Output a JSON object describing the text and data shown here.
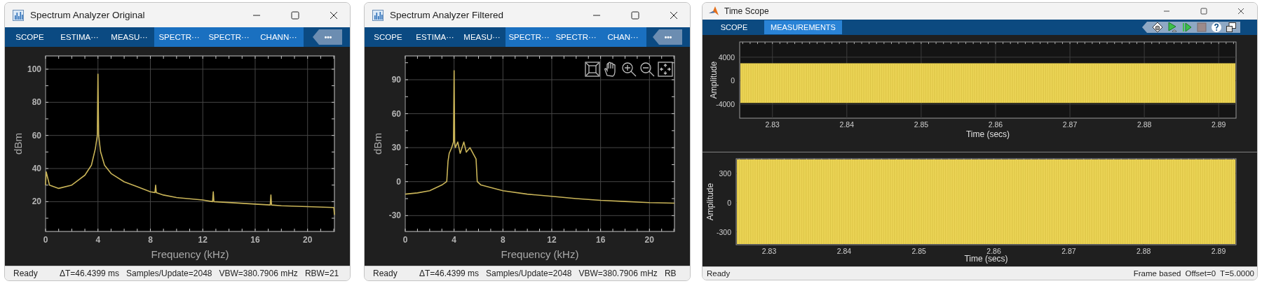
{
  "windows": [
    {
      "kind": "spectrum",
      "title": "Spectrum Analyzer Original",
      "tabs": [
        {
          "label": "SCOPE",
          "kind": "main"
        },
        {
          "label": "ESTIMA···",
          "kind": "main"
        },
        {
          "label": "MEASU···",
          "kind": "main"
        },
        {
          "label": "SPECTR···",
          "kind": "contextual"
        },
        {
          "label": "SPECTR···",
          "kind": "contextual"
        },
        {
          "label": "CHANN···",
          "kind": "contextual"
        }
      ],
      "overflow_button": "•••",
      "plot": {
        "chart_data": {
          "type": "line",
          "grid": true,
          "xlabel": "Frequency (kHz)",
          "ylabel": "dBm",
          "xlim": [
            0,
            22.05
          ],
          "ylim": [
            2,
            108
          ],
          "xticks": [
            0,
            4,
            8,
            12,
            16,
            20
          ],
          "yticks": [
            20,
            40,
            60,
            80,
            100
          ],
          "x": [
            0,
            0.05,
            0.3,
            1,
            2,
            3,
            3.5,
            3.8,
            3.95,
            4,
            4.05,
            4.2,
            4.5,
            5,
            6,
            7,
            8,
            8.35,
            8.4,
            8.45,
            9,
            10,
            12,
            12.75,
            12.8,
            12.85,
            14,
            16,
            17.15,
            17.2,
            17.25,
            18,
            20,
            22,
            22.05
          ],
          "series": [
            {
              "color": "#c9b458",
              "values": [
                30,
                38,
                30,
                28,
                30,
                36,
                42,
                52,
                60,
                97,
                60,
                50,
                42,
                37,
                32,
                29,
                26,
                25.5,
                30,
                25.5,
                24,
                22.5,
                21,
                20,
                26,
                20,
                19.5,
                18.5,
                18,
                24,
                18,
                17.5,
                17,
                16.5,
                12
              ]
            }
          ]
        }
      },
      "status_bar": {
        "left": "Ready",
        "fields": [
          "ΔT=46.4399 ms",
          "Samples/Update=2048",
          "VBW=380.7906 mHz",
          "RBW=21"
        ]
      }
    },
    {
      "kind": "spectrum",
      "title": "Spectrum Analyzer Filtered",
      "tabs": [
        {
          "label": "SCOPE",
          "kind": "main"
        },
        {
          "label": "ESTIMA···",
          "kind": "main"
        },
        {
          "label": "MEASU···",
          "kind": "main"
        },
        {
          "label": "SPECTR···",
          "kind": "contextual"
        },
        {
          "label": "SPECTR···",
          "kind": "contextual"
        },
        {
          "label": "CHAN···",
          "kind": "contextual"
        }
      ],
      "overflow_button": "•••",
      "plot": {
        "navigation_tools": true,
        "chart_data": {
          "type": "line",
          "grid": true,
          "xlabel": "Frequency (kHz)",
          "ylabel": "dBm",
          "xlim": [
            0,
            22.05
          ],
          "ylim": [
            -44,
            111
          ],
          "xticks": [
            0,
            4,
            8,
            12,
            16,
            20
          ],
          "yticks": [
            -30,
            0,
            30,
            60,
            90
          ],
          "x": [
            0,
            1,
            2,
            3,
            3.4,
            3.5,
            3.6,
            3.8,
            3.95,
            4,
            4.05,
            4.1,
            4.3,
            4.5,
            4.8,
            5,
            5.3,
            5.6,
            5.8,
            5.9,
            6.2,
            8,
            10,
            12,
            14,
            16,
            18,
            20,
            22,
            22.05
          ],
          "series": [
            {
              "color": "#c9b458",
              "values": [
                -11,
                -10,
                -8,
                -3,
                0,
                18,
                25,
                30,
                35,
                98,
                35,
                30,
                35,
                25,
                35,
                26,
                30,
                24,
                20,
                0,
                -3,
                -8,
                -11,
                -13,
                -15,
                -16.5,
                -17.5,
                -18.5,
                -19,
                -19
              ]
            }
          ]
        }
      },
      "status_bar": {
        "left": "Ready",
        "fields": [
          "ΔT=46.4399 ms",
          "Samples/Update=2048",
          "VBW=380.7906 mHz",
          "RB"
        ]
      }
    },
    {
      "kind": "scope",
      "title": "Time Scope",
      "tabs": [
        {
          "label": "SCOPE",
          "kind": "main"
        },
        {
          "label": "MEASUREMENTS",
          "kind": "contextual"
        }
      ],
      "panels": [
        {
          "xlabel": "Time (secs)",
          "ylabel": "Amplitude",
          "xticks": [
            "2.83",
            "2.84",
            "2.85",
            "2.86",
            "2.87",
            "2.88",
            "2.89"
          ],
          "yticks": [
            "4000",
            "0",
            "-4000"
          ]
        },
        {
          "xlabel": "Time (secs)",
          "ylabel": "Amplitude",
          "xticks": [
            "2.83",
            "2.84",
            "2.85",
            "2.86",
            "2.87",
            "2.88",
            "2.89"
          ],
          "yticks": [
            "300",
            "0",
            "-300"
          ]
        }
      ],
      "status_bar": {
        "left": "Ready",
        "fields": [
          "Frame based",
          "Offset=0",
          "T=5.0000"
        ]
      }
    }
  ]
}
